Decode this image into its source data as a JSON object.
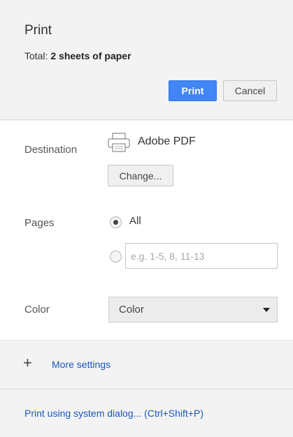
{
  "header": {
    "title": "Print",
    "total_prefix": "Total:",
    "total_value": "2 sheets of paper",
    "print_label": "Print",
    "cancel_label": "Cancel"
  },
  "destination": {
    "label": "Destination",
    "name": "Adobe PDF",
    "icon": "printer-icon",
    "change_label": "Change..."
  },
  "pages": {
    "label": "Pages",
    "all_label": "All",
    "selected": "All",
    "custom_placeholder": "e.g. 1-5, 8, 11-13",
    "custom_value": ""
  },
  "color": {
    "label": "Color",
    "selected": "Color"
  },
  "more_settings": {
    "icon": "plus-icon",
    "label": "More settings"
  },
  "system_dialog": {
    "label": "Print using system dialog... (Ctrl+Shift+P)"
  },
  "colors": {
    "accent": "#4285f4",
    "link": "#1a57b9",
    "panel_bg": "#f3f3f3"
  }
}
